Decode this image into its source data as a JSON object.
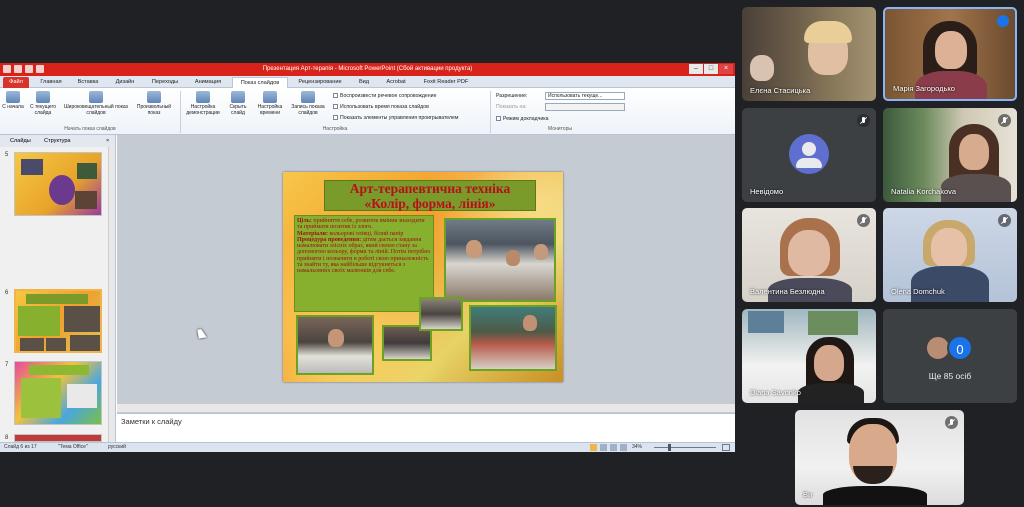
{
  "ppt": {
    "window_title": "Презентация Арт-терапія - Microsoft PowerPoint (Сбой активации продукта)",
    "tabs": [
      "Файл",
      "Главная",
      "Вставка",
      "Дизайн",
      "Переходы",
      "Анимация",
      "Показ слайдов",
      "Рецензирование",
      "Вид",
      "Acrobat",
      "Foxit Reader PDF"
    ],
    "active_tab": "Показ слайдов",
    "ribbon": {
      "btn_from_start": "С начала",
      "btn_from_current": "С текущего слайда",
      "btn_broadcast": "Широковещательный показ слайдов",
      "btn_custom": "Произвольный показ",
      "group_start": "Начать показ слайдов",
      "btn_setup": "Настройка демонстрации",
      "btn_hide": "Скрыть слайд",
      "btn_rehearse": "Настройка времени",
      "btn_record": "Запись показа слайдов",
      "chk_narration": "Воспроизвести речевое сопровождение",
      "chk_timings": "Использовать время показа слайдов",
      "chk_media": "Показать элементы управления проигрывателем",
      "group_setup": "Настройка",
      "resolution_label": "Разрешение:",
      "resolution_value": "Использовать текуще...",
      "show_on_label": "Показать на:",
      "presenter_view": "Режим докладчика",
      "group_monitors": "Мониторы"
    },
    "panel_tabs": [
      "Слайды",
      "Структура"
    ],
    "slide_numbers": [
      "5",
      "6",
      "7",
      "8"
    ],
    "slide": {
      "title_line1": "Арт-терапевтична техніка",
      "title_line2": "«Колір, форма, лінія»",
      "goal_label": "Ціль:",
      "goal_text": "прийняття себе, розвиток вміння знаходити та приймати позитив із злого.",
      "materials_label": "Матеріали:",
      "materials_text": "кольорові олівці, білий папір",
      "procedure_label": "Процедура проведення:",
      "procedure_text": "дітям дається завдання намалювати злісніх образ, який своєю стану за допомогою кольору, форми та ліній. Потім потрібно прийняти і позначити в роботі свою приналежність та знайти ту, яка найбільше відгукнеться з намальовних своїх малюнків для себе."
    },
    "notes_placeholder": "Заметки к слайду",
    "status": {
      "slide_info": "Слайд 6 из 17",
      "theme": "\"Тема Office\"",
      "language": "русский",
      "zoom": "34%"
    }
  },
  "meet": {
    "participants": [
      {
        "name": "Елєна Стасицька"
      },
      {
        "name": "Марія Загородько"
      },
      {
        "name": "Невідомо"
      },
      {
        "name": "Natalia Korchakova"
      },
      {
        "name": "Валентина Безлюдна"
      },
      {
        "name": "Olena Domchuk"
      },
      {
        "name": "Diana Savonko"
      },
      {
        "name": "Ви"
      }
    ],
    "more_count": "0",
    "more_label": "Ще 85 осіб"
  }
}
